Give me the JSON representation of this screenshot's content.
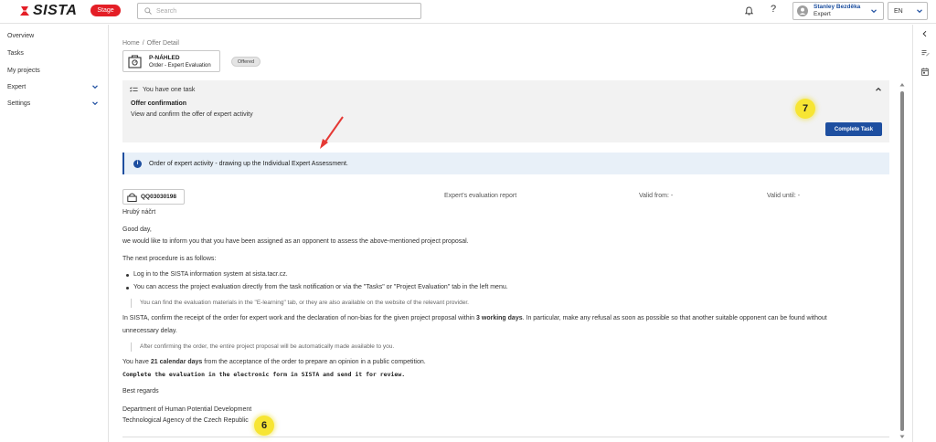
{
  "header": {
    "logo_text": "SISTA",
    "env_badge": "Stage",
    "search_placeholder": "Search",
    "help_label": "?",
    "user_name": "Stanley Bezděka",
    "user_role": "Expert",
    "language": "EN"
  },
  "sidebar": {
    "items": [
      {
        "label": "Overview"
      },
      {
        "label": "Tasks"
      },
      {
        "label": "My projects"
      },
      {
        "label": "Expert"
      },
      {
        "label": "Settings"
      }
    ]
  },
  "breadcrumb": {
    "home": "Home",
    "separator": "/",
    "current": "Offer Detail"
  },
  "document": {
    "code": "P-NÁHLED",
    "type": "Order - Expert Evaluation",
    "status": "Offered"
  },
  "task_panel": {
    "header": "You have one task",
    "title": "Offer confirmation",
    "description": "View and confirm the offer of expert activity",
    "button_label": "Complete Task"
  },
  "markers": {
    "top": "7",
    "bottom": "6"
  },
  "info_bar": {
    "icon": "i",
    "text": "Order of expert activity - drawing up the Individual Expert Assessment."
  },
  "attachment": {
    "code": "QQ03030198",
    "col_report": "Expert's evaluation report",
    "col_valid_from": "Valid from: -",
    "col_valid_until": "Valid until: -",
    "draft_label": "Hrubý náčrt"
  },
  "letter": {
    "greeting": "Good day,",
    "intro": "we would like to inform you that you have been assigned as an opponent to assess the above-mentioned project proposal.",
    "procedure_intro": "The next procedure is as follows:",
    "bullets": [
      "Log in to the SISTA information system at sista.tacr.cz.",
      "You can access the project evaluation directly from the task notification or via the \"Tasks\" or \"Project Evaluation\" tab in the left menu."
    ],
    "quote1": "You can find the evaluation materials in the \"E-learning\" tab, or they are also available on the website of the relevant provider.",
    "para_confirm_start": "In SISTA, confirm the receipt of the order for expert work and the declaration of non-bias for the given project proposal within ",
    "para_confirm_bold": "3 working days",
    "para_confirm_end": ". In particular, make any refusal as soon as possible so that another suitable opponent can be found without",
    "para_confirm_line2": "unnecessary delay.",
    "quote2": "After confirming the order, the entire project proposal will be automatically made available to you.",
    "para_days_start": "You have ",
    "para_days_bold": "21 calendar days",
    "para_days_end": " from the acceptance of the order to prepare an opinion in a public competition.",
    "mono_line": "Complete the evaluation in the electronic form in SISTA and send it for review.",
    "regards": "Best regards",
    "sign1": "Department of Human Potential Development",
    "sign2": "Technological Agency of the Czech Republic"
  },
  "colors": {
    "brand_red": "#e41e26",
    "primary_blue": "#1e4fa0",
    "marker_yellow": "#f7e533",
    "arrow_red": "#e53935"
  },
  "icons": [
    "sista-logo-icon",
    "search-icon",
    "bell-icon",
    "user-avatar-icon",
    "chevron-down-icon",
    "chevron-left-icon",
    "edit-list-icon",
    "calendar-icon",
    "task-list-icon",
    "chevron-up-icon",
    "info-icon",
    "document-icon",
    "lock-icon"
  ]
}
